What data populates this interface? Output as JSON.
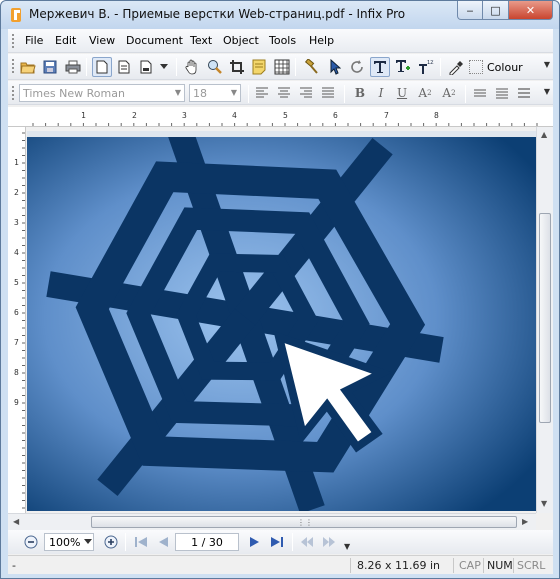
{
  "window": {
    "title": "Мержевич В. - Приемые верстки Web-страниц.pdf - Infix Pro",
    "buttons": {
      "minimize": "‒",
      "maximize": "□",
      "close": "✕"
    }
  },
  "menu": [
    "File",
    "Edit",
    "View",
    "Document",
    "Text",
    "Object",
    "Tools",
    "Help"
  ],
  "toolbar1": {
    "colour_label": "Colour",
    "icons": [
      "open-folder-icon",
      "save-icon",
      "print-icon",
      "single-page-icon",
      "facing-pages-icon",
      "continuous-pages-icon",
      "page-chevron-icon",
      "hand-icon",
      "zoom-icon",
      "crop-icon",
      "note-icon",
      "grid-icon",
      "hammer-icon",
      "select-arrow-icon",
      "rotate-icon",
      "text-tool-icon",
      "text-plus-icon",
      "text-numbering-icon",
      "eyedropper-icon",
      "colour-swatch-icon"
    ]
  },
  "toolbar2": {
    "font_family": "Times New Roman",
    "font_size": "18",
    "bold": "B",
    "italic": "I",
    "underline": "U",
    "superscript": "A",
    "superscript_mark": "2",
    "subscript": "A",
    "subscript_mark": "2"
  },
  "rulers": {
    "horizontal": [
      "1",
      "2",
      "3",
      "4",
      "5",
      "6",
      "7",
      "8"
    ],
    "vertical": [
      "1",
      "2",
      "3",
      "4",
      "5",
      "6",
      "7",
      "8",
      "9"
    ]
  },
  "navigation": {
    "zoom": "100%",
    "page": "1 / 30"
  },
  "status": {
    "dimensions": "8.26 x 11.69 in",
    "cap": "CAP",
    "num": "NUM",
    "scrl": "SCRL"
  },
  "colors": {
    "page_bg_light": "#9cc3ee",
    "page_bg_dark": "#0c3f74",
    "web_stroke": "#0b3564",
    "web_cell": "#9cc5ef",
    "cursor": "#ffffff"
  }
}
